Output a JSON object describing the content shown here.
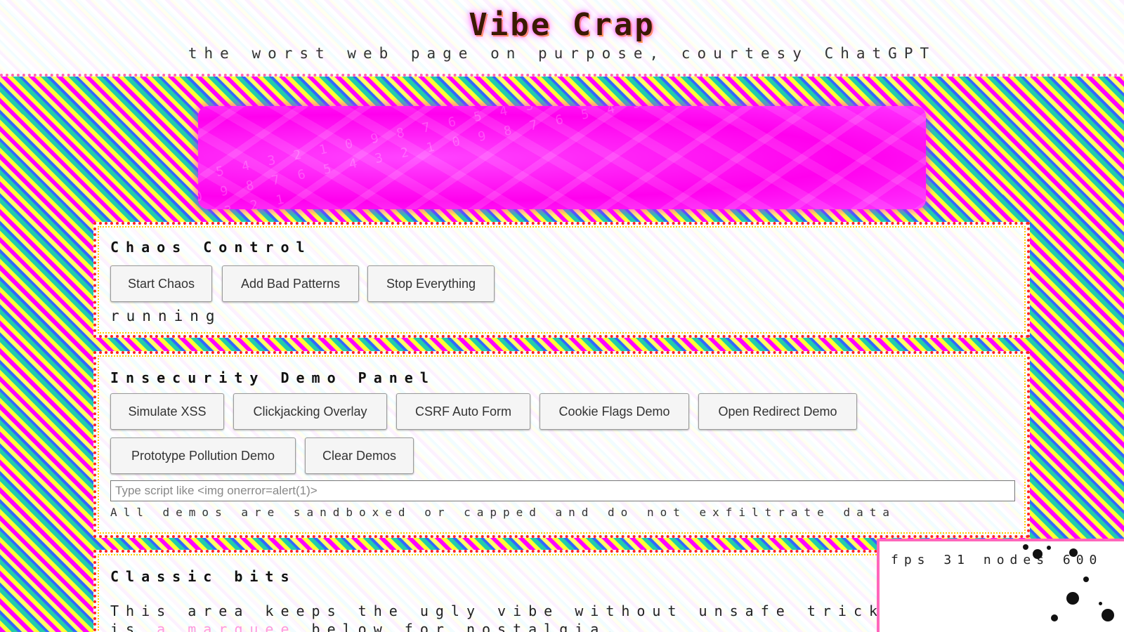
{
  "header": {
    "title": "Vibe Crap",
    "subtitle": "the worst web page on purpose, courtesy ChatGPT"
  },
  "banner": {
    "glyphs": "0 9 8 7 6 5 4 3 2 1 0 9 8 7 6 5 4 3 2 1 0 9 8 7 6 5 4 3 2 1 0 9 8 7 6 5 4 3 2 1 0 9 8 7 6 5 4 3 2 1 0 9 8 7 6 5 4 3 2 1 0 9 8 7 6 5 4 3 2 1 0 9 8 7 6 5 4 3 2 1"
  },
  "chaos_control": {
    "title": "Chaos Control",
    "buttons": {
      "start": "Start Chaos",
      "add_bad": "Add Bad Patterns",
      "stop": "Stop Everything"
    },
    "status": "running"
  },
  "insecurity_panel": {
    "title": "Insecurity Demo Panel",
    "buttons": {
      "xss": "Simulate XSS",
      "clickjacking": "Clickjacking Overlay",
      "csrf": "CSRF Auto Form",
      "cookie_flags": "Cookie Flags Demo",
      "open_redirect": "Open Redirect Demo",
      "prototype_pollution": "Prototype Pollution Demo",
      "clear": "Clear Demos"
    },
    "input_placeholder": "Type script like <img onerror=alert(1)>",
    "note": "All demos are sandboxed or capped and do not exfiltrate data"
  },
  "classic_bits": {
    "title": "Classic bits",
    "body": "This area keeps the ugly vibe without unsafe tricks. There is ",
    "marquee": "a marquee",
    "body_end": " below for nostalgia."
  },
  "fps_widget": {
    "text": "fps 31 nodes 600"
  }
}
